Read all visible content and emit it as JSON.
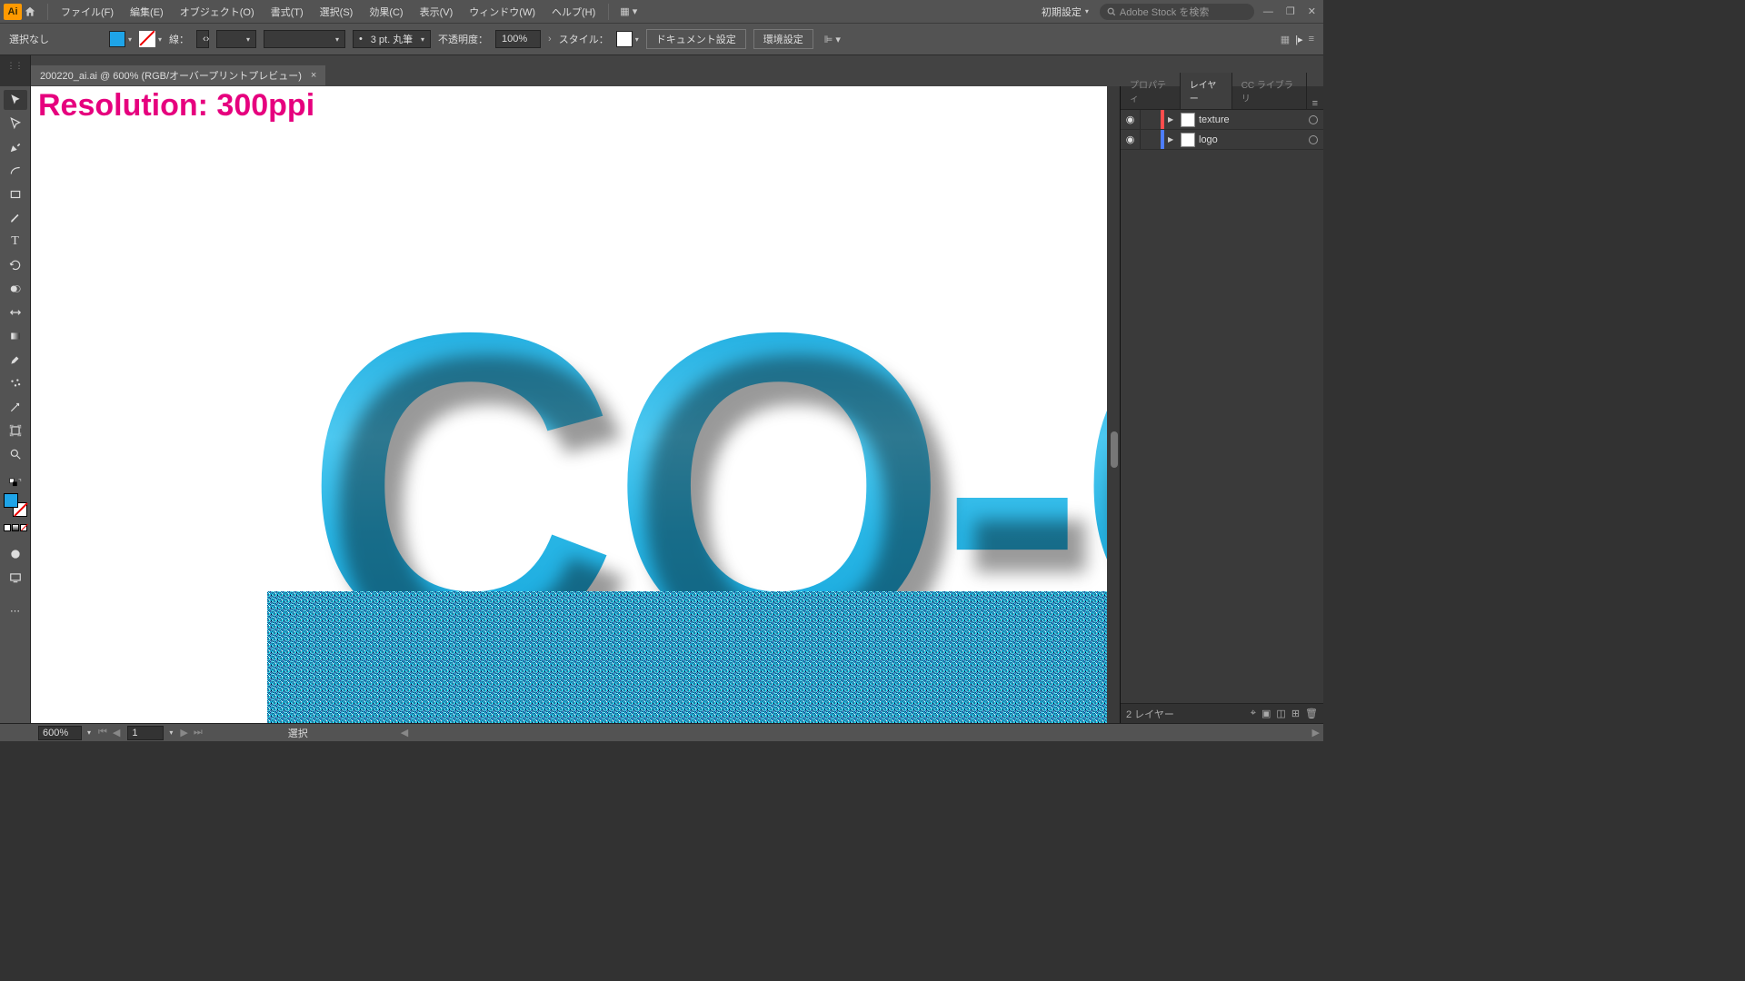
{
  "menu": {
    "items": [
      "ファイル(F)",
      "編集(E)",
      "オブジェクト(O)",
      "書式(T)",
      "選択(S)",
      "効果(C)",
      "表示(V)",
      "ウィンドウ(W)",
      "ヘルプ(H)"
    ],
    "workspace": "初期設定",
    "search_placeholder": "Adobe Stock を検索"
  },
  "control": {
    "selection": "選択なし",
    "fill_color": "#1ea4e8",
    "stroke_label": "線：",
    "stroke_weight": "",
    "brush": "3 pt. 丸筆",
    "opacity_label": "不透明度：",
    "opacity": "100%",
    "style_label": "スタイル：",
    "doc_setup": "ドキュメント設定",
    "prefs": "環境設定"
  },
  "document": {
    "tab": "200220_ai.ai @ 600% (RGB/オーバープリントプレビュー)"
  },
  "canvas": {
    "resolution_label": "Resolution: 300ppi",
    "big_text": "CO-C"
  },
  "panels": {
    "tabs": [
      "プロパティ",
      "レイヤー",
      "CC ライブラリ"
    ],
    "active_tab": 1,
    "layers": [
      {
        "name": "texture",
        "color": "#ff4d4d"
      },
      {
        "name": "logo",
        "color": "#4d7dff"
      }
    ],
    "footer": "2 レイヤー"
  },
  "status": {
    "zoom": "600%",
    "page": "1",
    "tool": "選択"
  }
}
